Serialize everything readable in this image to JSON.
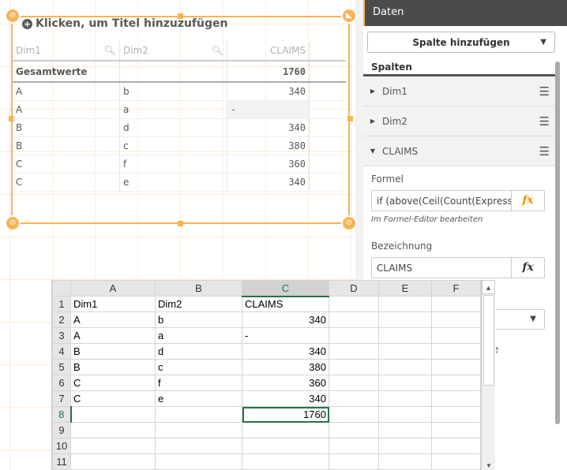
{
  "qlik": {
    "title_placeholder": "Klicken, um Titel hinzuzufügen",
    "table": {
      "headers": [
        "Dim1",
        "Dim2",
        "CLAIMS"
      ],
      "totals": {
        "label": "Gesamtwerte",
        "value": "1760"
      },
      "rows": [
        [
          "A",
          "b",
          "340"
        ],
        [
          "A",
          "a",
          "-"
        ],
        [
          "B",
          "d",
          "340"
        ],
        [
          "B",
          "c",
          "380"
        ],
        [
          "C",
          "f",
          "360"
        ],
        [
          "C",
          "e",
          "340"
        ]
      ],
      "sort_column": "Dim1"
    },
    "accent_color": "#f9b354"
  },
  "panel": {
    "header": "Daten",
    "add_column_label": "Spalte hinzufügen",
    "columns_title": "Spalten",
    "columns": [
      {
        "label": "Dim1",
        "expanded": false
      },
      {
        "label": "Dim2",
        "expanded": false
      },
      {
        "label": "CLAIMS",
        "expanded": true
      }
    ],
    "formula_label": "Formel",
    "formula_value": "if (above(Ceil(Count(Expressi",
    "formula_help": "Im Formel-Editor bearbeiten",
    "label_label": "Bezeichnung",
    "label_value": "CLAIMS",
    "fx": "fx",
    "partial_text": "e"
  },
  "excel": {
    "columns": [
      "A",
      "B",
      "C",
      "D",
      "E",
      "F"
    ],
    "selected_cell": "C8",
    "rows": [
      [
        "1",
        "Dim1",
        "Dim2",
        "CLAIMS"
      ],
      [
        "2",
        "A",
        "b",
        "340"
      ],
      [
        "3",
        "A",
        "a",
        "-"
      ],
      [
        "4",
        "B",
        "d",
        "340"
      ],
      [
        "5",
        "B",
        "c",
        "380"
      ],
      [
        "6",
        "C",
        "f",
        "360"
      ],
      [
        "7",
        "C",
        "e",
        "340"
      ],
      [
        "8",
        "",
        "",
        "1760"
      ],
      [
        "9",
        "",
        "",
        ""
      ],
      [
        "10",
        "",
        "",
        ""
      ],
      [
        "11",
        "",
        "",
        ""
      ]
    ],
    "selection_color": "#217346"
  }
}
